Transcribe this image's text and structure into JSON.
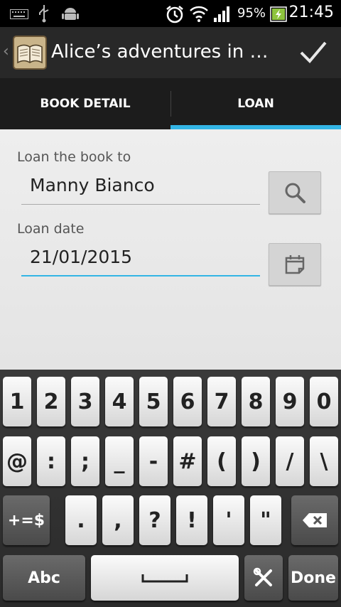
{
  "status_bar": {
    "battery_percent": "95%",
    "time": "21:45",
    "icons": [
      "keyboard-icon",
      "usb-icon",
      "android-debug-icon",
      "alarm-icon",
      "wifi-icon",
      "signal-icon",
      "battery-charging-icon"
    ]
  },
  "action_bar": {
    "title": "Alice’s adventures in W…",
    "logo_icon": "book-icon",
    "confirm_icon": "check-icon"
  },
  "tabs": [
    {
      "label": "BOOK DETAIL",
      "selected": false
    },
    {
      "label": "LOAN",
      "selected": true
    }
  ],
  "colors": {
    "accent": "#33b5e5",
    "action_bar": "#282828",
    "tab_bar": "#1c1c1c",
    "content_bg": "#eeeeee"
  },
  "loan_form": {
    "borrower_label": "Loan the book to",
    "borrower_value": "Manny Bianco",
    "date_label": "Loan date",
    "date_value": "21/01/2015",
    "search_icon": "search-icon",
    "calendar_icon": "calendar-icon"
  },
  "keyboard": {
    "row1": [
      "1",
      "2",
      "3",
      "4",
      "5",
      "6",
      "7",
      "8",
      "9",
      "0"
    ],
    "row2": [
      "@",
      ":",
      ";",
      "_",
      "-",
      "#",
      "(",
      ")",
      "/",
      "\\"
    ],
    "row3": [
      "+=$",
      ".",
      ",",
      "?",
      "!",
      "'",
      "\""
    ],
    "abc": "Abc",
    "done": "Done",
    "backspace_icon": "backspace-icon",
    "settings_icon": "tools-icon"
  }
}
